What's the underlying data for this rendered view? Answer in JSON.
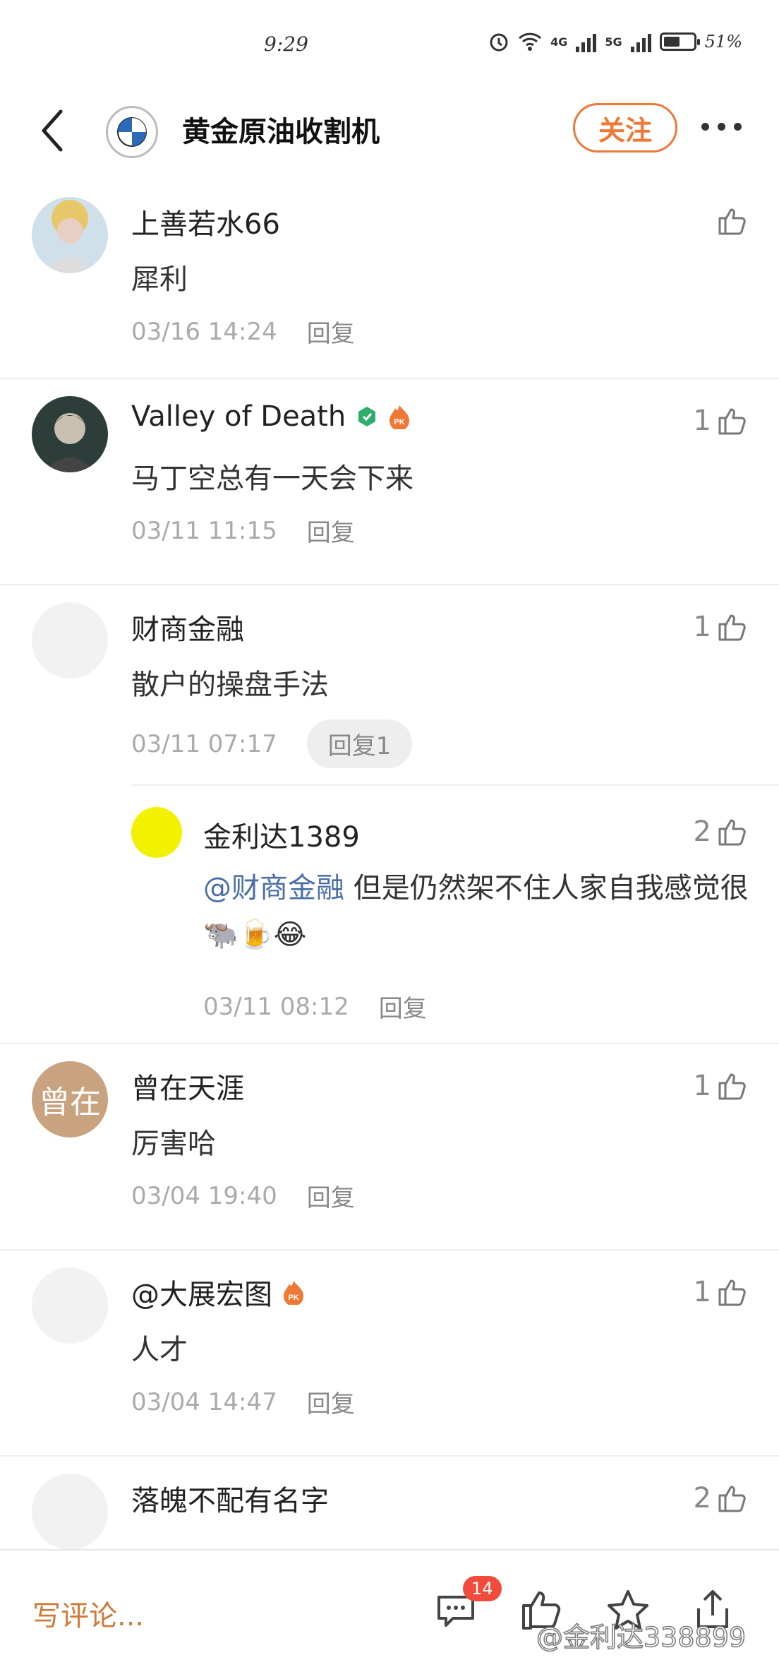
{
  "status": {
    "time": "9:29",
    "net1": "4G",
    "net2": "5G",
    "battery_pct": "51%",
    "battery_level": 0.51
  },
  "header": {
    "title": "黄金原油收割机",
    "follow_label": "关注"
  },
  "comments": [
    {
      "user": "上善若水66",
      "text": "犀利",
      "time": "03/16 14:24",
      "reply": "回复",
      "likes": ""
    },
    {
      "user": "Valley of Death",
      "text": "马丁空总有一天会下来",
      "time": "03/11 11:15",
      "reply": "回复",
      "likes": "1"
    },
    {
      "user": "财商金融",
      "text": "散户的操盘手法",
      "time": "03/11 07:17",
      "reply": "回复1",
      "likes": "1",
      "subreply": {
        "user": "金利达1389",
        "mention": "@财商金融",
        "text": " 但是仍然架不住人家自我感觉很",
        "emojis": "🐃🍺😂",
        "time": "03/11 08:12",
        "reply": "回复",
        "likes": "2"
      }
    },
    {
      "user": "曾在天涯",
      "avatar_text": "曾在",
      "text": "厉害哈",
      "time": "03/04 19:40",
      "reply": "回复",
      "likes": "1"
    },
    {
      "user": "@大展宏图",
      "text": "人才",
      "time": "03/04 14:47",
      "reply": "回复",
      "likes": "1"
    },
    {
      "user": "落魄不配有名字",
      "text": "",
      "time": "",
      "reply": "",
      "likes": "2"
    }
  ],
  "bottom": {
    "write_placeholder": "写评论...",
    "comment_count": "14",
    "watermark": "@金利达338899"
  },
  "colors": {
    "accent": "#f07835",
    "mention": "#4a6fa5",
    "badge": "#f04b3b"
  }
}
